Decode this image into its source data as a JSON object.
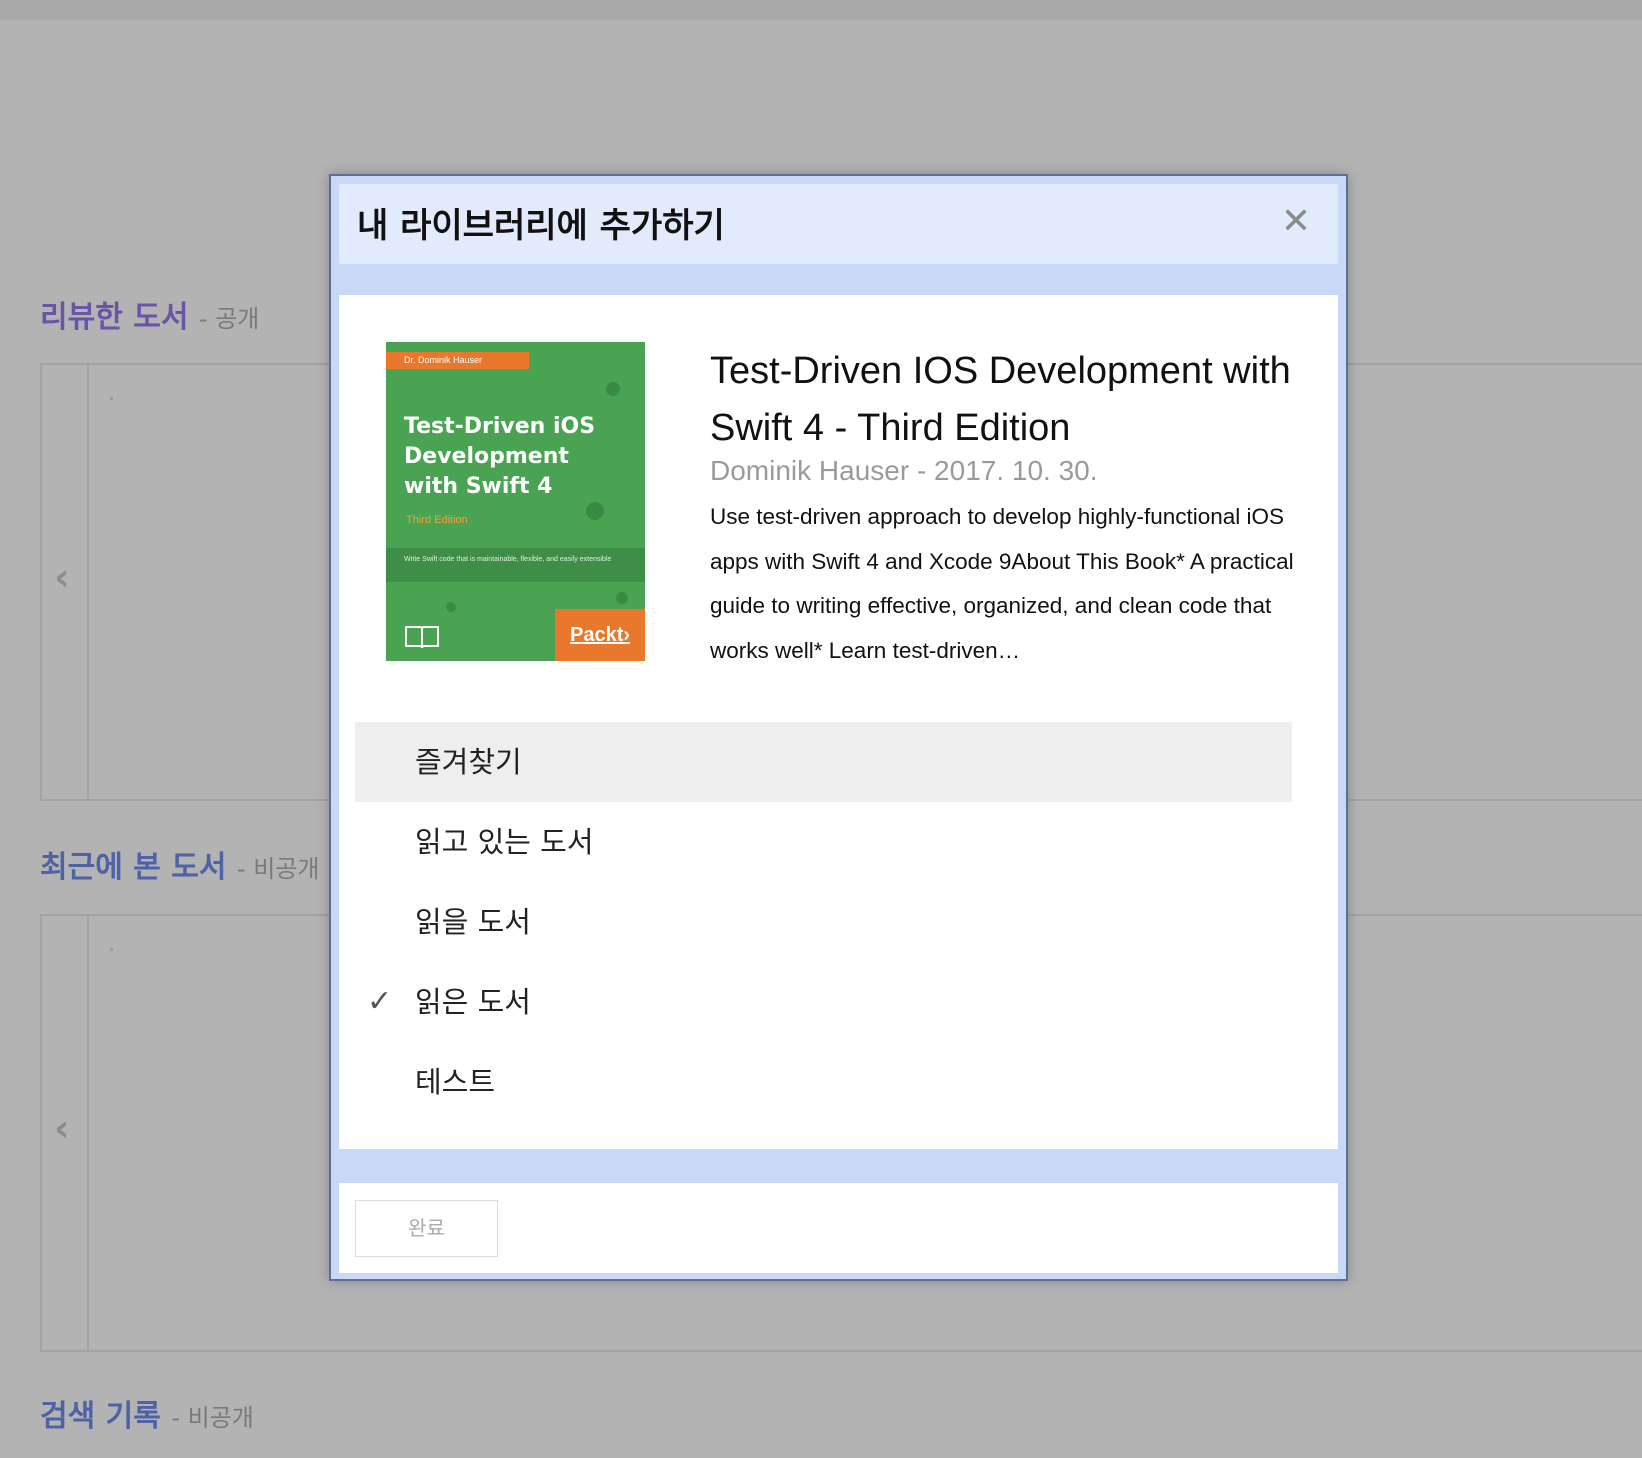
{
  "background": {
    "sections": [
      {
        "title": "리뷰한 도서",
        "visibility": "- 공개",
        "color": "#6a54a8"
      },
      {
        "title": "최근에 본 도서",
        "visibility": "- 비공개",
        "color": "#4e62a8"
      },
      {
        "title": "검색 기록",
        "visibility": "- 비공개",
        "color": "#4e62a8"
      }
    ],
    "prev_glyph": "‹"
  },
  "modal": {
    "title": "내 라이브러리에 추가하기",
    "close_glyph": "✕",
    "book": {
      "cover": {
        "author": "Dr. Dominik Hauser",
        "title": "Test-Driven iOS Development with Swift 4",
        "edition": "Third Edition",
        "tagline": "Write Swift code that is maintainable, flexible, and easily extensible",
        "publisher": "Packt›",
        "book_icon": "open-book-icon"
      },
      "title": "Test-Driven IOS Development with Swift 4 - Third Edition",
      "meta": "Dominik Hauser - 2017. 10. 30.",
      "description": "Use test-driven approach to develop highly-functional iOS apps with Swift 4 and Xcode 9About This Book* A practical guide to writing effective, organized, and clean code that works well* Learn test-driven…"
    },
    "shelves": [
      {
        "label": "즐겨찾기",
        "checked": false,
        "hover": true
      },
      {
        "label": "읽고 있는 도서",
        "checked": false,
        "hover": false
      },
      {
        "label": "읽을 도서",
        "checked": false,
        "hover": false
      },
      {
        "label": "읽은 도서",
        "checked": true,
        "hover": false
      },
      {
        "label": "테스트",
        "checked": false,
        "hover": false
      }
    ],
    "check_glyph": "✓",
    "done_label": "완료"
  },
  "colors": {
    "overlay": "#b3b3b3",
    "modal_frame": "#c8d8f7",
    "modal_header": "#e1ebfb",
    "cover_green": "#4aa353",
    "cover_orange": "#e9782d"
  }
}
